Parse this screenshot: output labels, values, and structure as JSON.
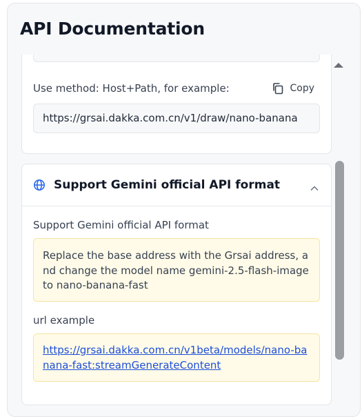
{
  "panel": {
    "title": "API Documentation"
  },
  "card1": {
    "method_label": "Use method: Host+Path, for example:",
    "copy_label": "Copy",
    "example_url": "https://grsai.dakka.com.cn/v1/draw/nano-banana"
  },
  "card2": {
    "header_title": "Support Gemini official API format",
    "section_label": "Support Gemini official API format",
    "note_text": "Replace the base address with the Grsai address, and change the model name gemini-2.5-flash-image to nano-banana-fast",
    "url_label": "url example",
    "url_example": "https://grsai.dakka.com.cn/v1beta/models/nano-banana-fast:streamGenerateContent"
  },
  "icons": [
    "copy-icon",
    "globe-icon",
    "chevron-up-icon",
    "scroll-up-arrow-icon"
  ],
  "colors": {
    "link": "#1d4ed8",
    "note_bg": "#fffbe8",
    "note_border": "#f6e3a0"
  }
}
